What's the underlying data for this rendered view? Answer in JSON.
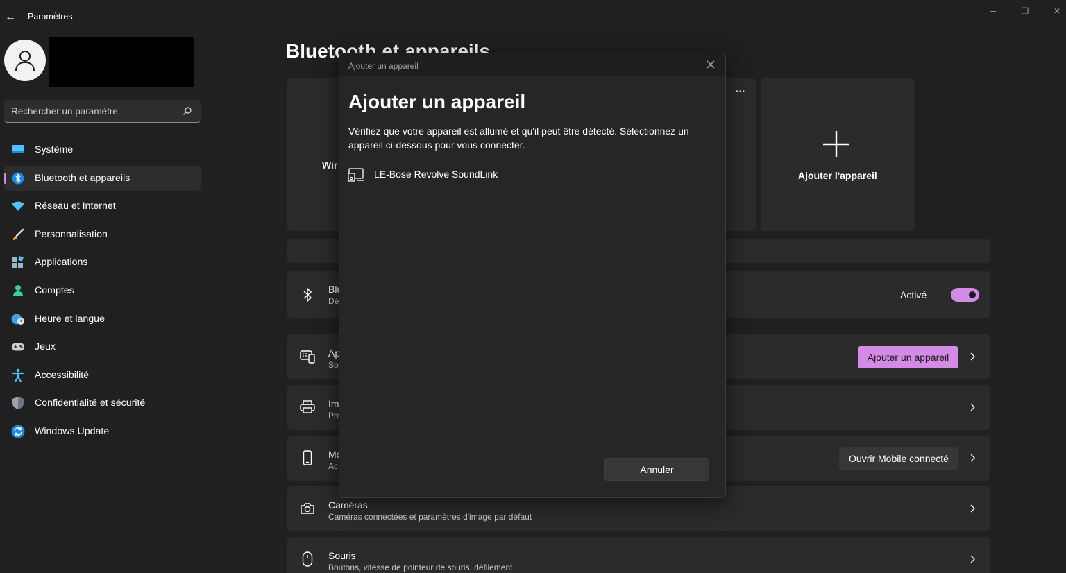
{
  "window": {
    "title": "Paramètres",
    "back_glyph": "←",
    "minimize_glyph": "─",
    "restore_glyph": "❐",
    "close_glyph": "✕"
  },
  "sidebar": {
    "search_placeholder": "Rechercher un paramètre",
    "items": [
      {
        "label": "Système",
        "icon": "monitor-icon",
        "active": false
      },
      {
        "label": "Bluetooth et appareils",
        "icon": "bluetooth-icon",
        "active": true
      },
      {
        "label": "Réseau et Internet",
        "icon": "wifi-icon",
        "active": false
      },
      {
        "label": "Personnalisation",
        "icon": "brush-icon",
        "active": false
      },
      {
        "label": "Applications",
        "icon": "apps-icon",
        "active": false
      },
      {
        "label": "Comptes",
        "icon": "person-icon",
        "active": false
      },
      {
        "label": "Heure et langue",
        "icon": "globe-clock-icon",
        "active": false
      },
      {
        "label": "Jeux",
        "icon": "gamepad-icon",
        "active": false
      },
      {
        "label": "Accessibilité",
        "icon": "accessibility-icon",
        "active": false
      },
      {
        "label": "Confidentialité et sécurité",
        "icon": "shield-icon",
        "active": false
      },
      {
        "label": "Windows Update",
        "icon": "update-icon",
        "active": false
      }
    ]
  },
  "main": {
    "page_title": "Bluetooth et appareils",
    "tile_partial_label": "Wir",
    "more_glyph": "···",
    "add_tile_label": "Ajouter l'appareil",
    "bluetooth_row": {
      "title": "Blu",
      "subtitle": "Dé",
      "status": "Activé"
    },
    "devices_row": {
      "title": "Ap",
      "subtitle": "So",
      "button": "Ajouter un appareil"
    },
    "printers_row": {
      "title": "Im",
      "subtitle": "Pré"
    },
    "mobile_row": {
      "title": "Mo",
      "subtitle": "Ac",
      "button": "Ouvrir Mobile connecté"
    },
    "cameras_row": {
      "title": "Caméras",
      "subtitle": "Caméras connectées et paramètres d'image par défaut"
    },
    "mouse_row": {
      "title": "Souris",
      "subtitle": "Boutons, vitesse de pointeur de souris, défilement"
    }
  },
  "dialog": {
    "window_title": "Ajouter un appareil",
    "heading": "Ajouter un appareil",
    "description": "Vérifiez que votre appareil est allumé et qu'il peut être détecté. Sélectionnez un appareil ci-dessous pour vous connecter.",
    "devices": [
      {
        "name": "LE-Bose Revolve SoundLink"
      }
    ],
    "cancel_label": "Annuler"
  },
  "colors": {
    "accent": "#d48be6",
    "background": "#202020",
    "card": "#2b2b2b",
    "dialog": "#262626"
  }
}
